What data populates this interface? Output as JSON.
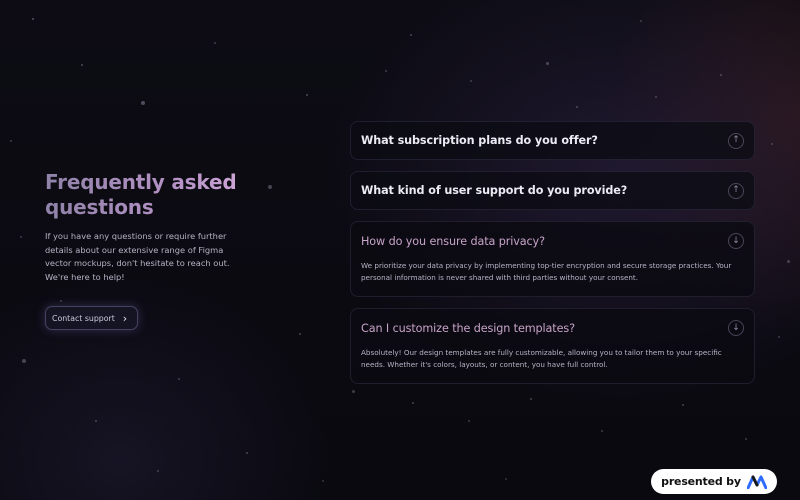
{
  "hero": {
    "title": "Frequently asked questions",
    "intro": "If you have any questions or require further details about our extensive range of Figma vector mockups, don't hesitate to reach out. We're here to help!",
    "contact_label": "Contact support",
    "contact_icon": "chevron-right-icon"
  },
  "faq": {
    "items": [
      {
        "question": "What subscription plans do you offer?",
        "state": "collapsed",
        "icon": "arrow-up-circle-icon"
      },
      {
        "question": "What kind of user support do you provide?",
        "state": "collapsed",
        "icon": "arrow-up-circle-icon"
      },
      {
        "question": "How do you ensure data privacy?",
        "state": "expanded",
        "icon": "arrow-down-circle-icon",
        "answer": "We prioritize your data privacy by implementing top-tier encryption and secure storage practices. Your personal information is never shared with third parties without your consent."
      },
      {
        "question": "Can I customize the design templates?",
        "state": "expanded",
        "icon": "arrow-down-circle-icon",
        "answer": "Absolutely! Our design templates are fully customizable, allowing you to tailor them to your specific needs. Whether it's colors, layouts, or content, you have full control."
      }
    ]
  },
  "badge": {
    "label": "presented by",
    "logo_icon": "brand-logo-icon"
  },
  "colors": {
    "background": "#0b0a12",
    "title_gradient_start": "#8f82a8",
    "title_gradient_end": "#cfa7d6",
    "question_text": "#eceaf3",
    "expanded_question_text": "#c7a3c8",
    "body_text": "#b7b3c4",
    "badge_bg": "#ffffff",
    "logo_blue": "#2f6bff"
  }
}
